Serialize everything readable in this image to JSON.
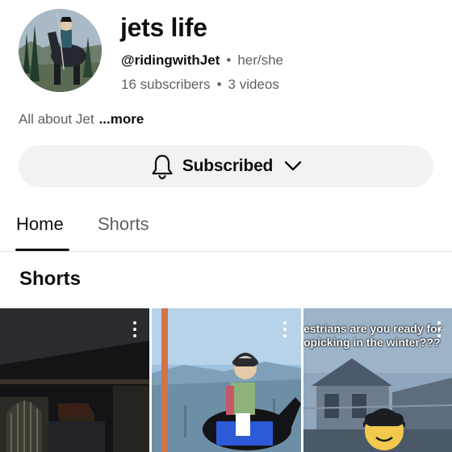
{
  "channel": {
    "name": "jets life",
    "handle": "@ridingwithJet",
    "pronouns": "her/she",
    "subscribers": "16 subscribers",
    "videos": "3 videos",
    "about": "All about Jet",
    "more": "...more"
  },
  "subscribe": {
    "label": "Subscribed",
    "bell_icon": "bell-icon",
    "chevron_icon": "chevron-down-icon"
  },
  "tabs": [
    {
      "label": "Home",
      "active": true
    },
    {
      "label": "Shorts",
      "active": false
    }
  ],
  "section": {
    "title": "Shorts"
  },
  "shorts": [
    {
      "caption": []
    },
    {
      "caption": []
    },
    {
      "caption": [
        "estrians are you ready for",
        "opicking in the winter???"
      ]
    }
  ]
}
